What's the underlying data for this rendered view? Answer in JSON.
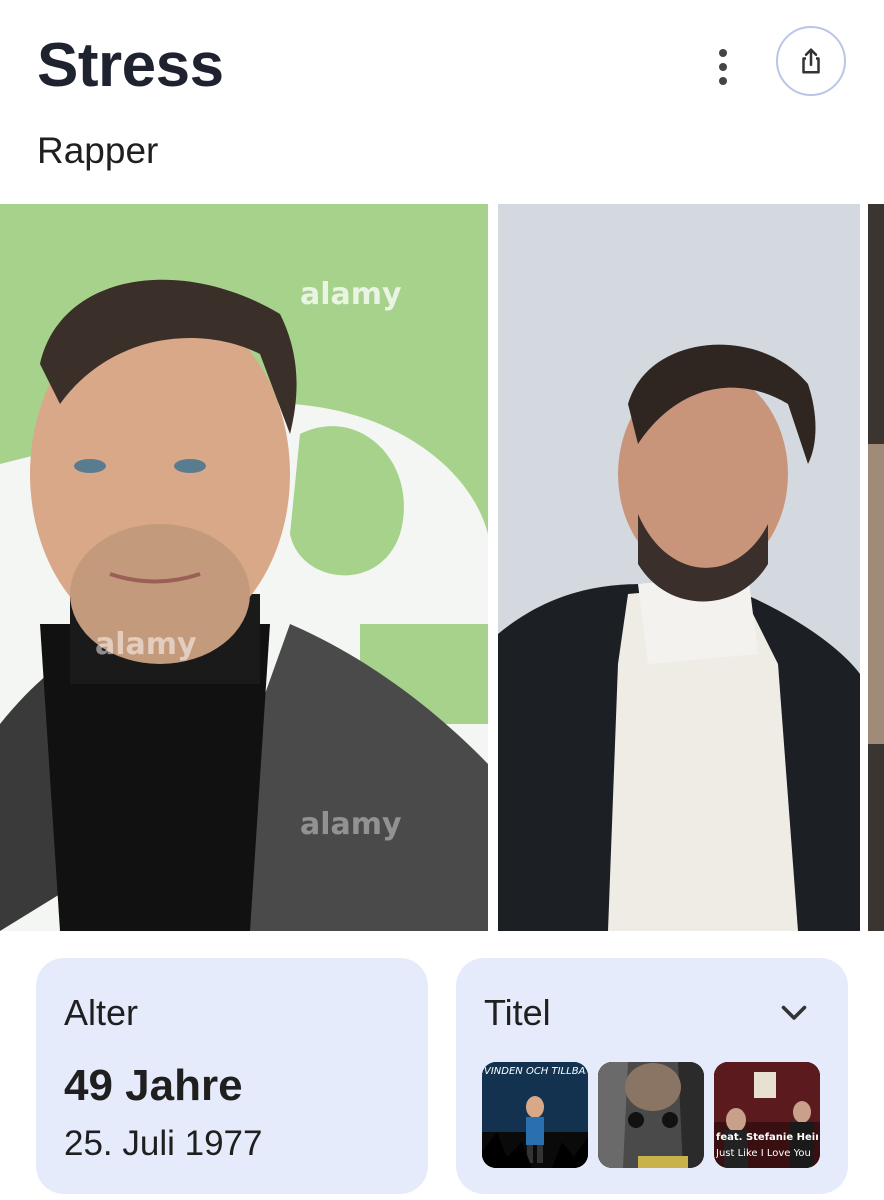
{
  "header": {
    "title": "Stress",
    "subtitle": "Rapper",
    "more_icon": "more-vert-icon",
    "share_icon": "share-icon"
  },
  "gallery": {
    "watermark": "alamy"
  },
  "age_card": {
    "label": "Alter",
    "value": "49 Jahre",
    "birthdate": "25. Juli 1977"
  },
  "titles_card": {
    "label": "Titel",
    "expand_icon": "chevron-down-icon",
    "thumbs": [
      {
        "caption": "VINDEN OCH TILLBAKA"
      },
      {
        "caption": ""
      },
      {
        "caption": "feat. Stefanie Heinzmann",
        "caption2": "Just Like I Love You"
      }
    ]
  },
  "colors": {
    "card_bg": "#e6ebfb",
    "title_color": "#1f2330",
    "share_border": "#b9c6e8"
  }
}
